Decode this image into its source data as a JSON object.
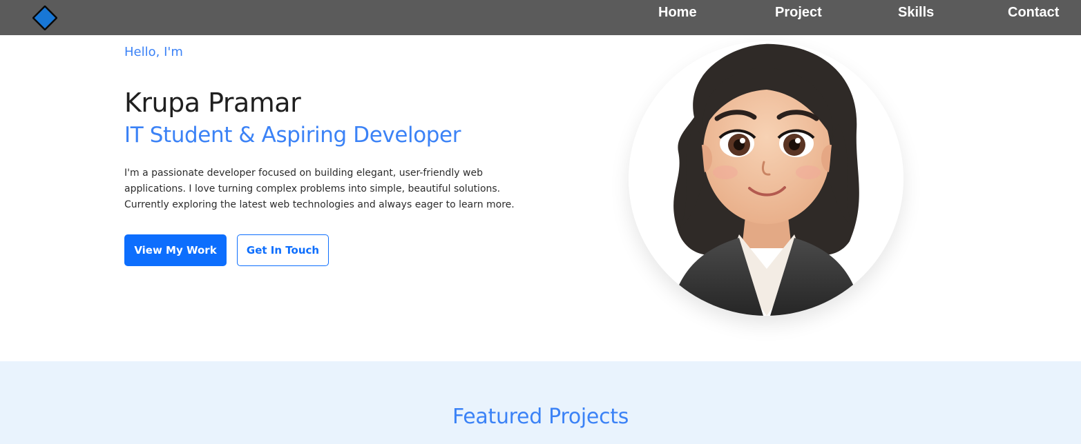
{
  "nav": {
    "logo_icon": "diamond-logo-icon",
    "links": [
      {
        "label": "Home"
      },
      {
        "label": "Project"
      },
      {
        "label": "Skills"
      },
      {
        "label": "Contact"
      }
    ]
  },
  "hero": {
    "greeting": "Hello, I'm",
    "name": "Krupa Pramar",
    "role": "IT Student & Aspiring Developer",
    "bio": "I'm a passionate developer focused on building elegant, user-friendly web applications. I love turning complex problems into simple, beautiful solutions. Currently exploring the latest web technologies and always eager to learn more.",
    "primary_button": "View My Work",
    "secondary_button": "Get In Touch"
  },
  "projects": {
    "title": "Featured Projects"
  },
  "colors": {
    "navbar": "#5b5b5b",
    "accent": "#3b82f6",
    "button": "#0d6efd",
    "section_bg": "#e9f3fd",
    "logo_fill": "#1877d6"
  }
}
